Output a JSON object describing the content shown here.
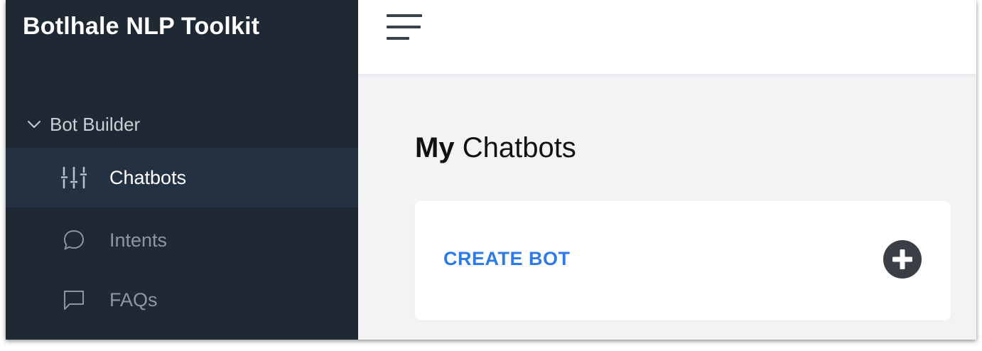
{
  "app": {
    "brand": "Botlhale NLP Toolkit"
  },
  "sidebar": {
    "group": {
      "label": "Bot Builder",
      "icon": "chevron-down-icon"
    },
    "items": [
      {
        "label": "Chatbots",
        "icon": "sliders-icon",
        "active": true
      },
      {
        "label": "Intents",
        "icon": "chat-bubble-round-icon",
        "active": false
      },
      {
        "label": "FAQs",
        "icon": "chat-bubble-square-icon",
        "active": false
      }
    ]
  },
  "header": {
    "menu_icon": "hamburger-icon"
  },
  "main": {
    "title_bold": "My",
    "title_rest": "Chatbots",
    "card": {
      "create_label": "CREATE BOT",
      "add_icon": "plus-circle-icon"
    }
  },
  "colors": {
    "sidebar_bg": "#1f2933",
    "sidebar_active_bg": "#233142",
    "accent_link": "#2f7ae5",
    "main_bg": "#f3f3f6",
    "plus_button": "#3a3f46"
  }
}
